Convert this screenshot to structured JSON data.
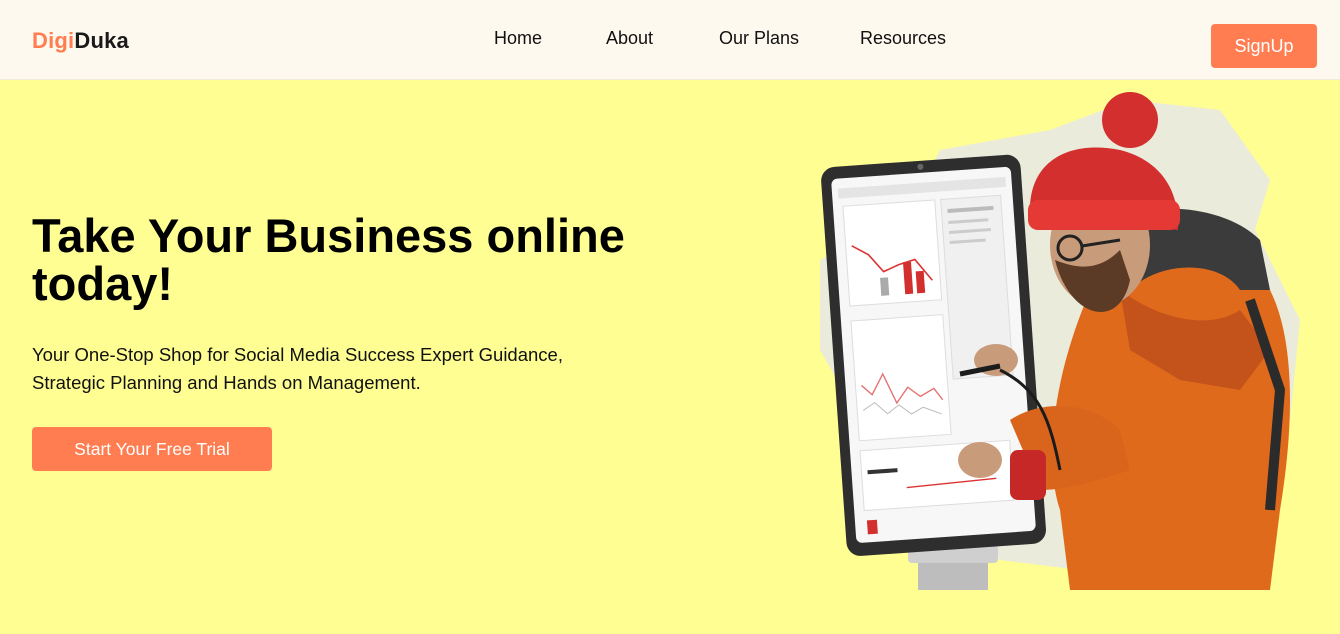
{
  "brand": {
    "part1": "Digi",
    "part2": "Duka",
    "accent_color": "#ff7d51"
  },
  "nav": {
    "items": [
      {
        "label": "Home"
      },
      {
        "label": "About"
      },
      {
        "label": "Our Plans"
      },
      {
        "label": "Resources"
      }
    ],
    "signup_label": "SignUp"
  },
  "hero": {
    "title": "Take Your Business online today!",
    "subtitle": "Your One-Stop Shop for Social Media Success Expert Guidance, Strategic Planning and Hands on Management.",
    "cta_label": "Start Your Free Trial",
    "background": "#fefe92",
    "illustration_icon": "man-with-tablet-analytics-illustration"
  }
}
